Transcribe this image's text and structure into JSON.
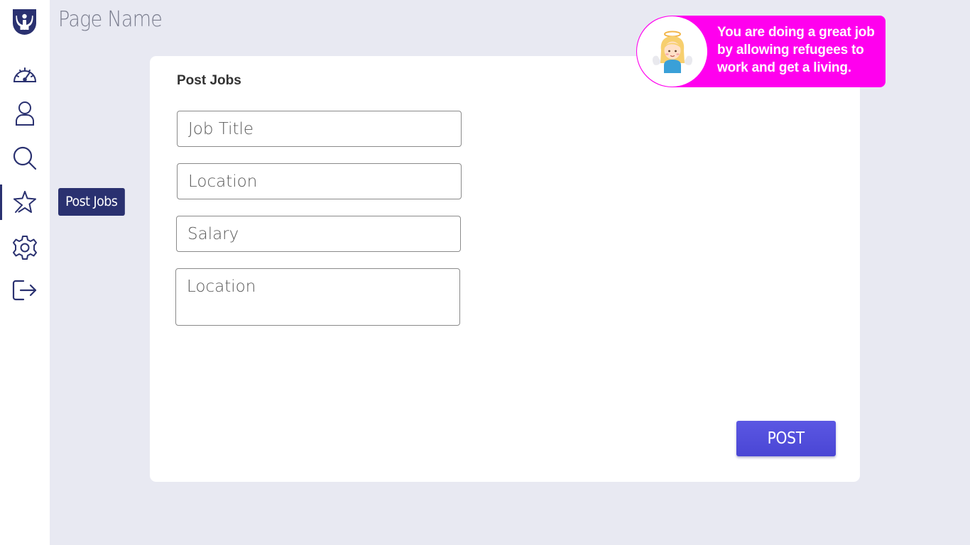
{
  "header": {
    "title": "Page Name"
  },
  "sidebar": {
    "logo": "refugee-hands-logo",
    "items": [
      {
        "name": "dashboard",
        "icon": "speedometer-icon"
      },
      {
        "name": "profile",
        "icon": "user-icon"
      },
      {
        "name": "search",
        "icon": "search-icon"
      },
      {
        "name": "post-jobs",
        "icon": "pin-icon",
        "active": true
      },
      {
        "name": "settings",
        "icon": "gear-icon"
      },
      {
        "name": "logout",
        "icon": "logout-icon"
      }
    ],
    "tooltip": "Post Jobs",
    "accent": "#2a3170"
  },
  "card": {
    "title": "Post Jobs",
    "fields": [
      {
        "placeholder": "Job Title",
        "value": ""
      },
      {
        "placeholder": "Location",
        "value": ""
      },
      {
        "placeholder": "Salary",
        "value": ""
      },
      {
        "placeholder": "Location",
        "value": ""
      }
    ],
    "post_label": "POST",
    "button_color": "#4e4ad8"
  },
  "message": {
    "text": "You are doing a great job by allowing refugees to work and get a living.",
    "avatar": "angel-icon",
    "color": "#ff00ee"
  }
}
